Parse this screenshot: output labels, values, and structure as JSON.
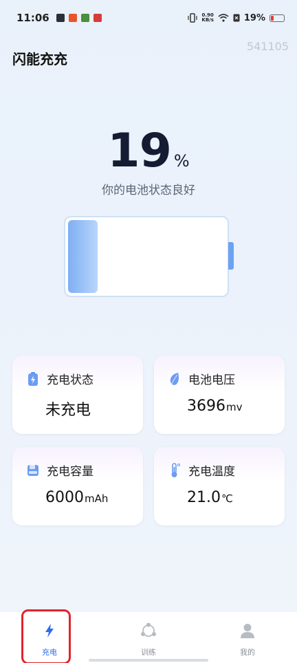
{
  "status_bar": {
    "time": "11:06",
    "net_speed_value": "0.90",
    "net_speed_unit": "KB/s",
    "battery_percent": "19%"
  },
  "page": {
    "title": "闪能充充",
    "corner_id": "541105"
  },
  "battery": {
    "percent_value": "19",
    "percent_symbol": "%",
    "level": 0.19,
    "status_message": "你的电池状态良好"
  },
  "cards": {
    "charge_status": {
      "label": "充电状态",
      "value": "未充电",
      "unit": ""
    },
    "battery_voltage": {
      "label": "电池电压",
      "value": "3696",
      "unit": "mv"
    },
    "charge_capacity": {
      "label": "充电容量",
      "value": "6000",
      "unit": "mAh"
    },
    "charge_temperature": {
      "label": "充电温度",
      "value": "21.0",
      "unit": "℃"
    }
  },
  "tabs": [
    {
      "label": "充电",
      "icon": "lightning-icon",
      "active": true
    },
    {
      "label": "训练",
      "icon": "share-circle-icon",
      "active": false
    },
    {
      "label": "我的",
      "icon": "person-icon",
      "active": false
    }
  ],
  "colors": {
    "accent": "#2f6bf0",
    "battery_fill": "#7faff4",
    "highlight_border": "#e0242c",
    "low_battery": "#e53935"
  }
}
